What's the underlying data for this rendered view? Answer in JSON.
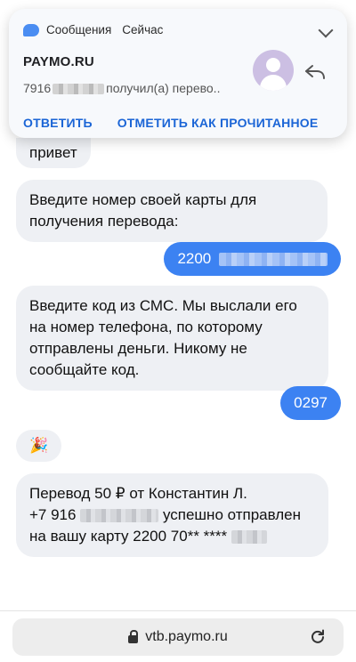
{
  "notification": {
    "app_name": "Сообщения",
    "time": "Сейчас",
    "sender": "PAYMO.RU",
    "preview_prefix": "7916",
    "preview_suffix": "получил(а) перево..",
    "actions": [
      "ОТВЕТИТЬ",
      "ОТМЕТИТЬ КАК ПРОЧИТАННОЕ"
    ],
    "icons": [
      "chat-bubble-icon",
      "chevron-down-icon",
      "avatar-person-icon",
      "reply-arrow-icon"
    ]
  },
  "chat": {
    "msg_hello": "привет",
    "msg_enter_card": "Введите номер своей карты для получения перевода:",
    "msg_card_prefix": "2200",
    "msg_enter_code": "Введите код из СМС. Мы выслали его на номер телефона, по которому отправлены деньги. Никому не сообщайте код.",
    "msg_code": "0297",
    "msg_party": "🎉",
    "msg_transfer_line1": "Перевод 50 ₽ от Константин Л.",
    "msg_transfer_phone_prefix": "+7 916",
    "msg_transfer_phone_suffix": "успешно отправлен",
    "msg_transfer_line3": "на вашу карту 2200 70** ****"
  },
  "address_bar": {
    "url": "vtb.paymo.ru",
    "icons": [
      "lock-icon",
      "reload-icon"
    ]
  },
  "colors": {
    "accent_blue": "#3c82f2",
    "action_blue": "#1b65d6",
    "incoming_bubble": "#eef0f4"
  }
}
